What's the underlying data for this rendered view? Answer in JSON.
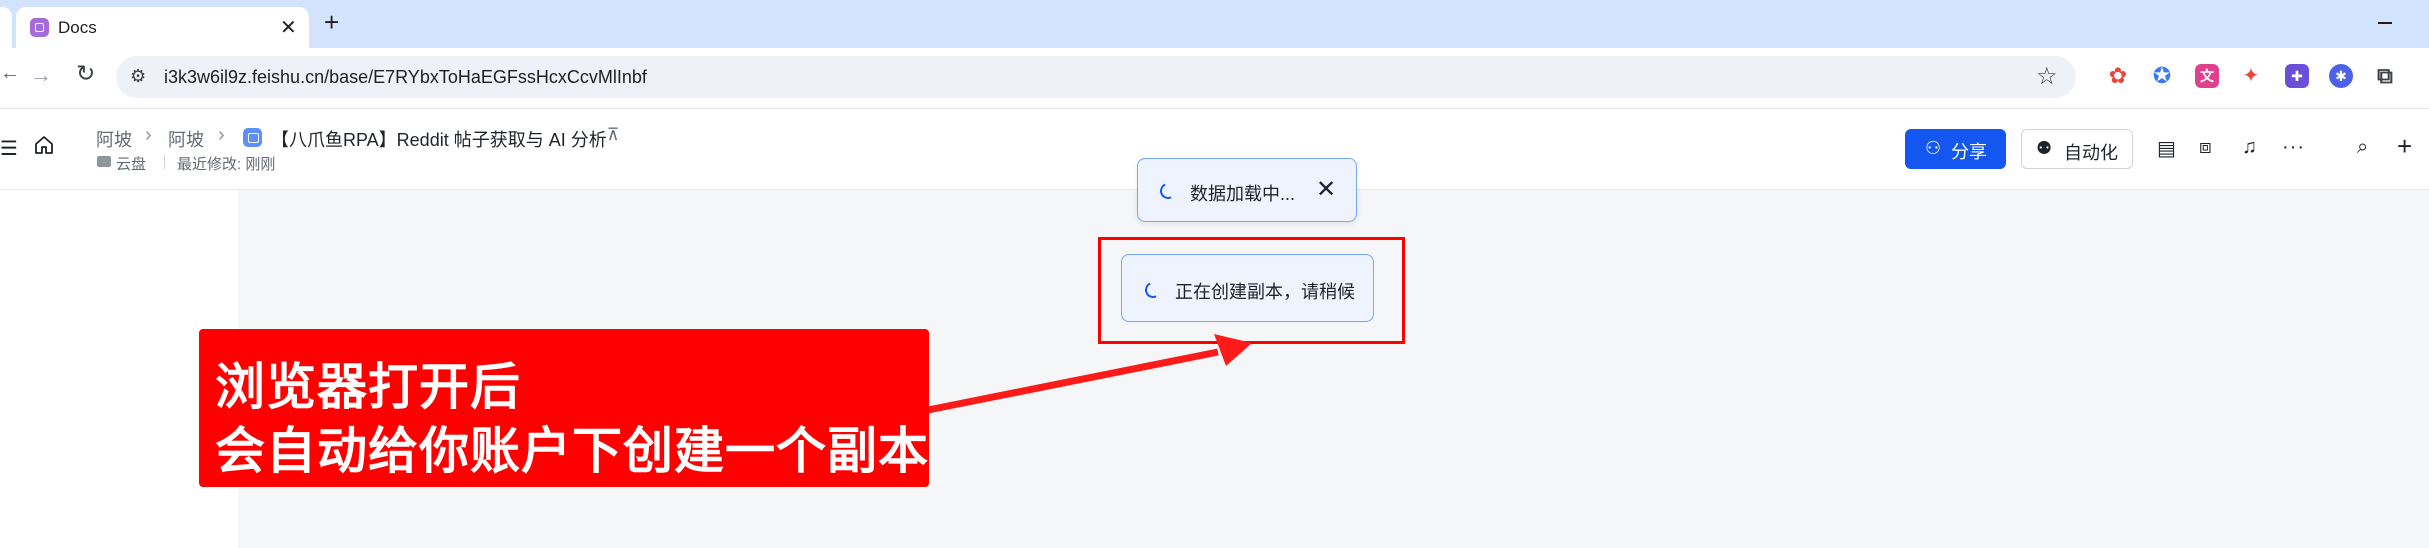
{
  "browser": {
    "tab_title": "Docs",
    "tab_close": "✕",
    "new_tab": "+",
    "url": "i3k3w6il9z.feishu.cn/base/E7RYbxToHaEGFssHcxCcvMlInbf"
  },
  "header": {
    "breadcrumbs": [
      "阿坡",
      "阿坡"
    ],
    "separator": "›",
    "doc_title": "【八爪鱼RPA】Reddit 帖子获取与 AI 分析",
    "location": "云盘",
    "last_modified": "最近修改: 刚刚",
    "share_label": "分享",
    "automation_label": "自动化"
  },
  "toasts": {
    "loading": "数据加载中...",
    "creating_copy": "正在创建副本，请稍候"
  },
  "annotation": {
    "line1": "浏览器打开后",
    "line2": "会自动给你账户下创建一个副本",
    "color": "#ff0000"
  },
  "colors": {
    "primary": "#1456f0",
    "tabstrip": "#d3e3fd",
    "canvas": "#f5f6f7"
  }
}
